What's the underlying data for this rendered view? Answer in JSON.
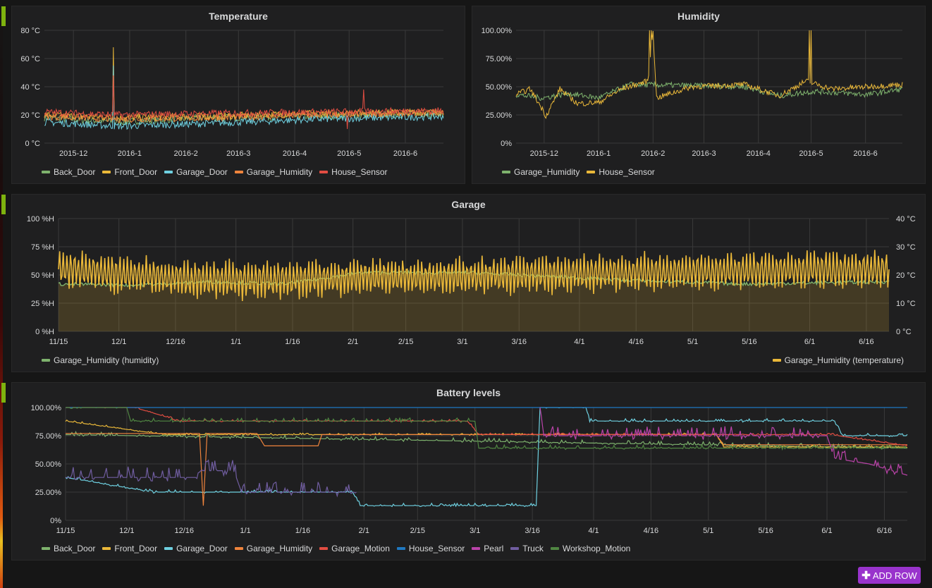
{
  "add_row_label": "ADD ROW",
  "add_row_icon": "plus-icon",
  "chart_data": [
    {
      "id": "temperature",
      "type": "line",
      "title": "Temperature",
      "xlabel": "",
      "ylabel": "",
      "x_ticks": [
        "2015-12",
        "2016-1",
        "2016-2",
        "2016-3",
        "2016-4",
        "2016-5",
        "2016-6"
      ],
      "x_range_days": [
        0,
        220
      ],
      "x_tick_days": [
        16,
        47,
        78,
        107,
        138,
        168,
        199
      ],
      "ylim": [
        0,
        80
      ],
      "y_ticks": [
        "0 °C",
        "20 °C",
        "40 °C",
        "60 °C",
        "80 °C"
      ],
      "grid": true,
      "legend": "bottom-left",
      "series": [
        {
          "name": "Back_Door",
          "color": "#7eb26d",
          "base": [
            [
              0,
              18
            ],
            [
              40,
              15
            ],
            [
              90,
              18
            ],
            [
              150,
              19
            ],
            [
              220,
              21
            ]
          ],
          "spikes": [
            [
              38,
              50
            ]
          ]
        },
        {
          "name": "Front_Door",
          "color": "#eab839",
          "base": [
            [
              0,
              20
            ],
            [
              40,
              18
            ],
            [
              90,
              19
            ],
            [
              150,
              21
            ],
            [
              220,
              22
            ]
          ],
          "spikes": [
            [
              38,
              68
            ]
          ]
        },
        {
          "name": "Garage_Door",
          "color": "#6ed0e0",
          "base": [
            [
              0,
              15
            ],
            [
              40,
              12
            ],
            [
              90,
              14
            ],
            [
              150,
              17
            ],
            [
              220,
              19
            ]
          ],
          "spikes": [
            [
              38,
              55
            ]
          ]
        },
        {
          "name": "Garage_Humidity",
          "color": "#ef843c",
          "base": [
            [
              0,
              19
            ],
            [
              40,
              17
            ],
            [
              90,
              18
            ],
            [
              150,
              20
            ],
            [
              220,
              22
            ]
          ],
          "spikes": []
        },
        {
          "name": "House_Sensor",
          "color": "#e24d42",
          "base": [
            [
              0,
              22
            ],
            [
              40,
              20
            ],
            [
              90,
              21
            ],
            [
              150,
              22
            ],
            [
              220,
              23
            ]
          ],
          "spikes": [
            [
              38,
              48
            ],
            [
              176,
              38
            ],
            [
              167,
              10
            ]
          ]
        }
      ]
    },
    {
      "id": "humidity",
      "type": "line",
      "title": "Humidity",
      "x_ticks": [
        "2015-12",
        "2016-1",
        "2016-2",
        "2016-3",
        "2016-4",
        "2016-5",
        "2016-6"
      ],
      "x_range_days": [
        0,
        220
      ],
      "x_tick_days": [
        16,
        47,
        78,
        107,
        138,
        168,
        199
      ],
      "ylim": [
        0,
        100
      ],
      "y_ticks": [
        "0%",
        "25.00%",
        "50.00%",
        "75.00%",
        "100.00%"
      ],
      "grid": true,
      "legend": "bottom-left",
      "series": [
        {
          "name": "Garage_Humidity",
          "color": "#7eb26d",
          "base": [
            [
              0,
              43
            ],
            [
              15,
              40
            ],
            [
              30,
              44
            ],
            [
              47,
              40
            ],
            [
              65,
              52
            ],
            [
              100,
              51
            ],
            [
              130,
              50
            ],
            [
              150,
              42
            ],
            [
              170,
              46
            ],
            [
              200,
              43
            ],
            [
              220,
              48
            ]
          ],
          "spikes": []
        },
        {
          "name": "House_Sensor",
          "color": "#eab839",
          "base": [
            [
              0,
              43
            ],
            [
              8,
              48
            ],
            [
              15,
              30
            ],
            [
              17,
              24
            ],
            [
              25,
              48
            ],
            [
              35,
              35
            ],
            [
              47,
              36
            ],
            [
              60,
              48
            ],
            [
              75,
              55
            ],
            [
              78,
              100
            ],
            [
              80,
              40
            ],
            [
              100,
              50
            ],
            [
              130,
              52
            ],
            [
              150,
              42
            ],
            [
              165,
              55
            ],
            [
              180,
              48
            ],
            [
              200,
              50
            ],
            [
              220,
              52
            ]
          ],
          "spikes": [
            [
              76,
              100
            ],
            [
              77,
              100
            ],
            [
              167,
              100
            ],
            [
              168,
              100
            ]
          ]
        }
      ]
    },
    {
      "id": "garage",
      "type": "area",
      "title": "Garage",
      "x_ticks": [
        "11/15",
        "12/1",
        "12/16",
        "1/1",
        "1/16",
        "2/1",
        "2/15",
        "3/1",
        "3/16",
        "4/1",
        "4/16",
        "5/1",
        "5/16",
        "6/1",
        "6/16"
      ],
      "x_range_days": [
        0,
        220
      ],
      "x_tick_days": [
        0,
        16,
        31,
        47,
        62,
        78,
        92,
        107,
        122,
        138,
        153,
        168,
        183,
        199,
        214
      ],
      "ylim_left": [
        0,
        100
      ],
      "ylim_right": [
        0,
        40
      ],
      "y_ticks_left": [
        "0 %H",
        "25 %H",
        "50 %H",
        "75 %H",
        "100 %H"
      ],
      "y_ticks_right": [
        "0 °C",
        "10 °C",
        "20 °C",
        "30 °C",
        "40 °C"
      ],
      "grid": true,
      "legend_left": "bottom-left",
      "legend_right": "bottom-right",
      "series": [
        {
          "name": "Garage_Humidity (humidity)",
          "axis": "left",
          "color": "#7eb26d",
          "fill": true,
          "base": [
            [
              0,
              42
            ],
            [
              20,
              41
            ],
            [
              40,
              44
            ],
            [
              60,
              42
            ],
            [
              80,
              52
            ],
            [
              110,
              52
            ],
            [
              140,
              47
            ],
            [
              180,
              42
            ],
            [
              220,
              44
            ]
          ],
          "amp": 3
        },
        {
          "name": "Garage_Humidity (temperature)",
          "axis": "right",
          "color": "#eab839",
          "fill": false,
          "base": [
            [
              0,
              22
            ],
            [
              40,
              18
            ],
            [
              80,
              19
            ],
            [
              120,
              20
            ],
            [
              160,
              21
            ],
            [
              220,
              22
            ]
          ],
          "amp": 7
        }
      ]
    },
    {
      "id": "battery",
      "type": "line",
      "title": "Battery levels",
      "x_ticks": [
        "11/15",
        "12/1",
        "12/16",
        "1/1",
        "1/16",
        "2/1",
        "2/15",
        "3/1",
        "3/16",
        "4/1",
        "4/16",
        "5/1",
        "5/16",
        "6/1",
        "6/16"
      ],
      "x_range_days": [
        0,
        220
      ],
      "x_tick_days": [
        0,
        16,
        31,
        47,
        62,
        78,
        92,
        107,
        122,
        138,
        153,
        168,
        183,
        199,
        214
      ],
      "ylim": [
        0,
        100
      ],
      "y_ticks": [
        "0%",
        "25.00%",
        "50.00%",
        "75.00%",
        "100.00%"
      ],
      "grid": true,
      "legend": "bottom-left",
      "series": [
        {
          "name": "Back_Door",
          "color": "#7eb26d",
          "steps": [
            [
              0,
              76
            ],
            [
              220,
              64
            ]
          ],
          "noise": 2
        },
        {
          "name": "Front_Door",
          "color": "#eab839",
          "steps": [
            [
              0,
              88
            ],
            [
              26,
              76
            ],
            [
              170,
              76
            ],
            [
              172,
              65
            ],
            [
              220,
              65
            ]
          ],
          "noise": 1
        },
        {
          "name": "Garage_Door",
          "color": "#6ed0e0",
          "steps": [
            [
              0,
              38
            ],
            [
              23,
              25
            ],
            [
              26,
              25
            ],
            [
              75,
              25
            ],
            [
              77,
              13
            ],
            [
              123,
              13
            ],
            [
              124,
              100
            ],
            [
              136,
              100
            ],
            [
              137,
              88
            ],
            [
              201,
              88
            ],
            [
              203,
              75
            ],
            [
              220,
              75
            ]
          ],
          "noise": 1.5
        },
        {
          "name": "Garage_Humidity",
          "color": "#ef843c",
          "steps": [
            [
              0,
              77
            ],
            [
              35,
              77
            ],
            [
              36,
              13
            ],
            [
              37,
              77
            ],
            [
              50,
              77
            ],
            [
              52,
              66
            ],
            [
              66,
              66
            ],
            [
              67,
              76
            ],
            [
              100,
              76
            ],
            [
              170,
              76
            ],
            [
              172,
              67
            ],
            [
              220,
              67
            ]
          ],
          "noise": 0
        },
        {
          "name": "Garage_Motion",
          "color": "#e24d42",
          "steps": [
            [
              0,
              100
            ],
            [
              18,
              100
            ],
            [
              28,
              90
            ],
            [
              29,
              88
            ],
            [
              105,
              88
            ],
            [
              108,
              76
            ],
            [
              200,
              76
            ],
            [
              220,
              66
            ]
          ],
          "noise": 1
        },
        {
          "name": "House_Sensor",
          "color": "#1f78c1",
          "steps": [
            [
              0,
              100
            ],
            [
              220,
              100
            ]
          ],
          "noise": 0
        },
        {
          "name": "Pearl",
          "color": "#ba43a9",
          "steps": [
            [
              124,
              100
            ],
            [
              125,
              75
            ],
            [
              199,
              75
            ],
            [
              201,
              55
            ],
            [
              210,
              50
            ],
            [
              220,
              40
            ]
          ],
          "noise": 6
        },
        {
          "name": "Truck",
          "color": "#705da0",
          "steps": [
            [
              0,
              38
            ],
            [
              34,
              38
            ],
            [
              35,
              44
            ],
            [
              44,
              44
            ],
            [
              46,
              25
            ],
            [
              76,
              25
            ]
          ],
          "noise": 7
        },
        {
          "name": "Workshop_Motion",
          "color": "#508642",
          "steps": [
            [
              0,
              100
            ],
            [
              16,
              100
            ],
            [
              17,
              88
            ],
            [
              77,
              88
            ],
            [
              107,
              88
            ],
            [
              108,
              64
            ],
            [
              220,
              64
            ]
          ],
          "noise": 2
        }
      ]
    }
  ]
}
